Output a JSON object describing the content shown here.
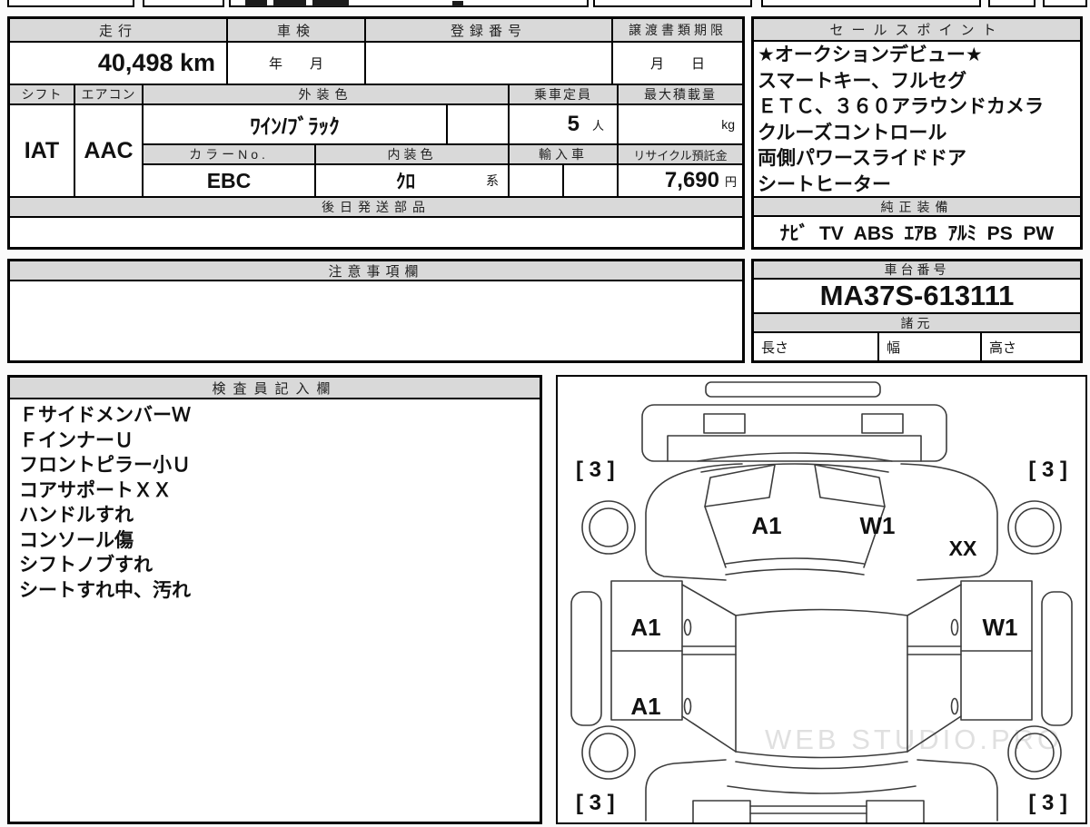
{
  "top_row": {
    "h_mileage": "走行",
    "h_shaken": "車検",
    "h_registration": "登録番号",
    "h_transfer_deadline": "譲渡書類期限",
    "mileage_value": "40,498 km",
    "shaken_placeholder": "年　　月",
    "registration_value": "",
    "transfer_placeholder": "月　　日"
  },
  "spec_row": {
    "h_shift": "シフト",
    "h_aircon": "エアコン",
    "h_exterior_color": "外装色",
    "h_capacity": "乗車定員",
    "h_max_load": "最大積載量",
    "shift_value": "IAT",
    "aircon_value": "AAC",
    "exterior_color_value": "ﾜｲﾝ/ﾌﾞﾗｯｸ",
    "capacity_value": "5",
    "capacity_unit": "人",
    "max_load_unit": "kg",
    "h_color_no": "カラーNo.",
    "h_interior_color": "内装色",
    "h_import_car": "輸入車",
    "h_recycle_deposit": "リサイクル預託金",
    "color_no_value": "EBC",
    "interior_color_value": "ｸﾛ",
    "interior_color_suffix": "系",
    "recycle_fee_value": "7,690",
    "recycle_fee_unit": "円"
  },
  "later_parts": {
    "header": "後日発送部品",
    "body": ""
  },
  "notes": {
    "header": "注意事項欄",
    "body": ""
  },
  "sales": {
    "header": "セールスポイント",
    "points": [
      "★オークションデビュー★",
      "スマートキー、フルセグ",
      "ＥＴＣ、３６０アラウンドカメラ",
      "クルーズコントロール",
      "両側パワースライドドア",
      "シートヒーター"
    ]
  },
  "equipment": {
    "header": "純正装備",
    "items": [
      "ﾅﾋﾞ",
      "TV",
      "ABS",
      "ｴｱB",
      "ｱﾙﾐ",
      "PS",
      "PW"
    ]
  },
  "chassis": {
    "header": "車台番号",
    "number": "MA37S-613111"
  },
  "dimensions": {
    "header": "諸元",
    "length_label": "長さ",
    "width_label": "幅",
    "height_label": "高さ",
    "length_value": "",
    "width_value": "",
    "height_value": ""
  },
  "inspector": {
    "header": "検査員記入欄",
    "lines": [
      "ＦサイドメンバーＷ",
      "ＦインナーＵ",
      "フロントピラー小Ｕ",
      "コアサポートＸＸ",
      "ハンドルすれ",
      "コンソール傷",
      "シフトノブすれ",
      "シートすれ中、汚れ"
    ]
  },
  "diagram": {
    "tire_front_left": "[ 3 ]",
    "tire_front_right": "[ 3 ]",
    "tire_rear_left": "[ 3 ]",
    "tire_rear_right": "[ 3 ]",
    "hood_left_mark": "A1",
    "hood_right_mark": "W1",
    "right_fender_mark": "XX",
    "door_front_left_mark": "A1",
    "door_rear_left_mark": "A1",
    "door_front_right_mark": "W1",
    "watermark": "WEB STUDIO.PRO"
  }
}
